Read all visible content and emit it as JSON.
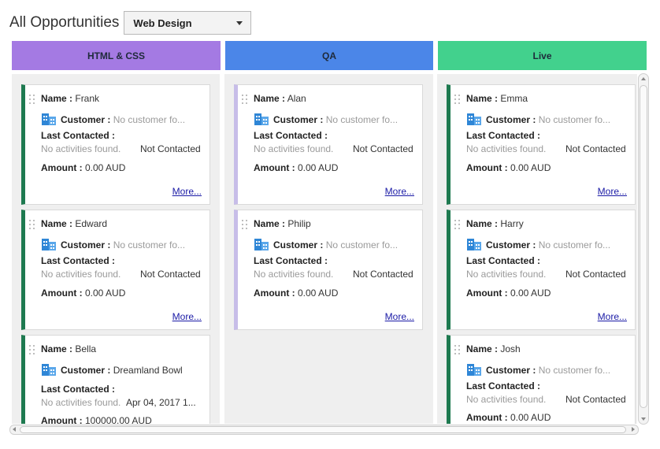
{
  "header": {
    "title": "All Opportunities",
    "pipeline_value": "Web Design"
  },
  "labels": {
    "name": "Name :",
    "customer": "Customer :",
    "last_contacted": "Last Contacted :",
    "amount": "Amount :",
    "more": "More..."
  },
  "colors": {
    "html_css": "#a47ae3",
    "qa": "#4b86e8",
    "live": "#42d18d",
    "card_accent_green": "#1e7a50",
    "card_accent_lavender": "#c7bde8",
    "link": "#1a1aa6"
  },
  "columns": [
    {
      "title": "HTML & CSS",
      "cards": [
        {
          "name": "Frank",
          "customer": "No customer fo...",
          "activity": "No activities found.",
          "status": "Not Contacted",
          "amount": "0.00 AUD"
        },
        {
          "name": "Edward",
          "customer": "No customer fo...",
          "activity": "No activities found.",
          "status": "Not Contacted",
          "amount": "0.00 AUD"
        },
        {
          "name": "Bella",
          "customer": "Dreamland Bowl",
          "activity": "No activities found.",
          "status": "Apr 04, 2017 1...",
          "amount": "100000.00 AUD"
        }
      ]
    },
    {
      "title": "QA",
      "cards": [
        {
          "name": "Alan",
          "customer": "No customer fo...",
          "activity": "No activities found.",
          "status": "Not Contacted",
          "amount": "0.00 AUD"
        },
        {
          "name": "Philip",
          "customer": "No customer fo...",
          "activity": "No activities found.",
          "status": "Not Contacted",
          "amount": "0.00 AUD"
        }
      ]
    },
    {
      "title": "Live",
      "cards": [
        {
          "name": "Emma",
          "customer": "No customer fo...",
          "activity": "No activities found.",
          "status": "Not Contacted",
          "amount": "0.00 AUD"
        },
        {
          "name": "Harry",
          "customer": "No customer fo...",
          "activity": "No activities found.",
          "status": "Not Contacted",
          "amount": "0.00 AUD"
        },
        {
          "name": "Josh",
          "customer": "No customer fo...",
          "activity": "No activities found.",
          "status": "Not Contacted",
          "amount": "0.00 AUD"
        }
      ]
    }
  ]
}
